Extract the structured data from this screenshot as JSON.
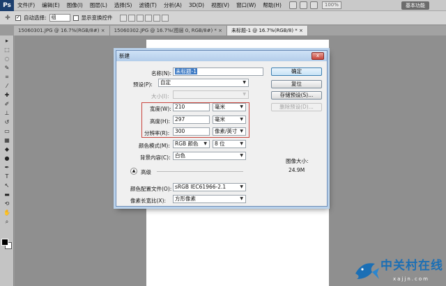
{
  "app": {
    "logo": "Ps",
    "menu": [
      "文件(F)",
      "编辑(E)",
      "图像(I)",
      "图层(L)",
      "选择(S)",
      "滤镜(T)",
      "分析(A)",
      "3D(D)",
      "视图(V)",
      "窗口(W)",
      "帮助(H)"
    ],
    "zoom": "100%",
    "workspace": "基本功能"
  },
  "options": {
    "auto_select_label": "自动选择:",
    "auto_select_value": "组",
    "show_transform_label": "显示变换控件"
  },
  "tabs": [
    {
      "label": "15060301.JPG @ 16.7%(RGB/8#)",
      "close": "×"
    },
    {
      "label": "15060302.JPG @ 16.7%(图层 0, RGB/8#) *",
      "close": "×"
    },
    {
      "label": "未标题-1 @ 16.7%(RGB/8) *",
      "close": "×"
    }
  ],
  "dialog": {
    "title": "新建",
    "close": "x",
    "name_label": "名称(N):",
    "name_value": "未标题-1",
    "preset_label": "预设(P):",
    "preset_value": "自定",
    "size_label": "大小(I):",
    "width_label": "宽度(W):",
    "width_value": "210",
    "width_unit": "毫米",
    "height_label": "高度(H):",
    "height_value": "297",
    "height_unit": "毫米",
    "resolution_label": "分辨率(R):",
    "resolution_value": "300",
    "resolution_unit": "像素/英寸",
    "color_mode_label": "颜色模式(M):",
    "color_mode_value": "RGB 颜色",
    "bit_depth_value": "8 位",
    "bg_label": "背景内容(C):",
    "bg_value": "白色",
    "advanced_label": "高级",
    "profile_label": "颜色配置文件(O):",
    "profile_value": "sRGB IEC61966-2.1",
    "pixel_aspect_label": "像素长宽比(X):",
    "pixel_aspect_value": "方形像素",
    "ok": "确定",
    "reset": "复位",
    "save_preset": "存储预设(S)...",
    "delete_preset": "删除预设(D)...",
    "image_size_label": "图像大小:",
    "image_size_value": "24.9M"
  },
  "watermark": {
    "text": "中关村在线",
    "sub": "xajjn.com"
  }
}
